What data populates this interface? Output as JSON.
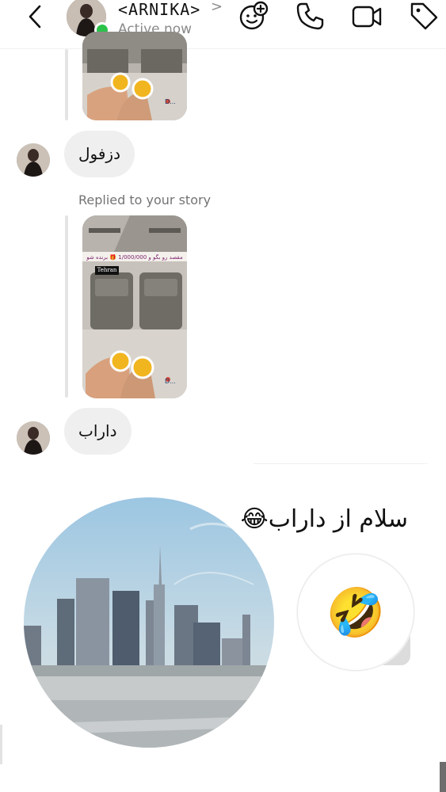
{
  "header": {
    "username": "<ARNIKA>",
    "status": "Active now"
  },
  "messages": {
    "story_reply_caption": "Replied to your story",
    "bubble_1": "دزفول",
    "bubble_2": "داراب",
    "sent_text": "سلام از داراب😂",
    "reaction_emoji": "🤣"
  },
  "story": {
    "banner_text": "مقصد رو بگو و 1/000/000 🎁 برنده شو",
    "city_label": "Tehran",
    "logo_text": "D..."
  },
  "colors": {
    "online": "#2bc24a",
    "bubble": "#efefef",
    "muted_text": "#737373"
  }
}
